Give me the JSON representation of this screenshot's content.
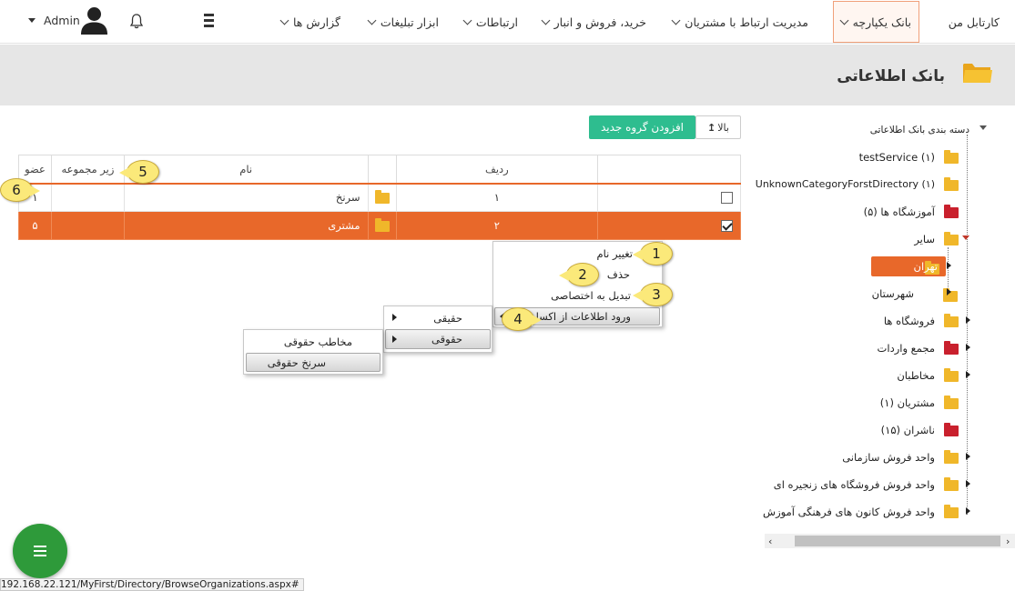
{
  "nav": {
    "items": [
      "کارتابل من",
      "بانک یکپارچه",
      "مدیریت ارتباط با مشتریان",
      "خرید، فروش و انبار",
      "ارتباطات",
      "ابزار تبلیغات",
      "گزارش ها"
    ],
    "user": "Admin"
  },
  "header": {
    "title": "بانک اطلاعاتی"
  },
  "toolbar": {
    "up": "بالا",
    "add_group": "افزودن گروه جدید"
  },
  "table": {
    "columns": [
      "ردیف",
      "نام",
      "زیر مجموعه",
      "عضو"
    ],
    "rows": [
      {
        "row": "۱",
        "name": "سرنخ",
        "sub": "",
        "member": "۱",
        "checked": false,
        "selected": false
      },
      {
        "row": "۲",
        "name": "مشتری",
        "sub": "",
        "member": "۵",
        "checked": true,
        "selected": true
      }
    ]
  },
  "context_menu": {
    "items": [
      "تغییر نام",
      "حذف",
      "تبدیل به اختصاصی",
      "ورود اطلاعات از اکسل"
    ]
  },
  "submenu1": {
    "items": [
      "حقیقی",
      "حقوقی"
    ]
  },
  "submenu2": {
    "items": [
      "مخاطب حقوقی",
      "سرنخ حقوقی"
    ]
  },
  "callouts": [
    "1",
    "2",
    "3",
    "4",
    "5",
    "6"
  ],
  "tree": {
    "root": "دسته بندی بانک اطلاعاتی",
    "items": [
      "testService (۱)",
      "UnknownCategoryForstDirectory (۱)",
      "آموزشگاه ها (۵)",
      "سایر",
      "تهران",
      "شهرستان",
      "فروشگاه ها",
      "مجمع واردات",
      "مخاطبان",
      "مشتریان (۱)",
      "ناشران (۱۵)",
      "واحد فروش سازمانی",
      "واحد فروش فروشگاه های زنجیره ای",
      "واحد فروش کانون های فرهنگی آموزش"
    ]
  },
  "status": {
    "url": "192.168.22.121/MyFirst/Directory/BrowseOrganizations.aspx#"
  },
  "colors": {
    "accent": "#e8682a",
    "green": "#2ebd8f",
    "fab": "#2e9a3a",
    "folder": "#f0b72a",
    "folder_red": "#c9202d"
  }
}
